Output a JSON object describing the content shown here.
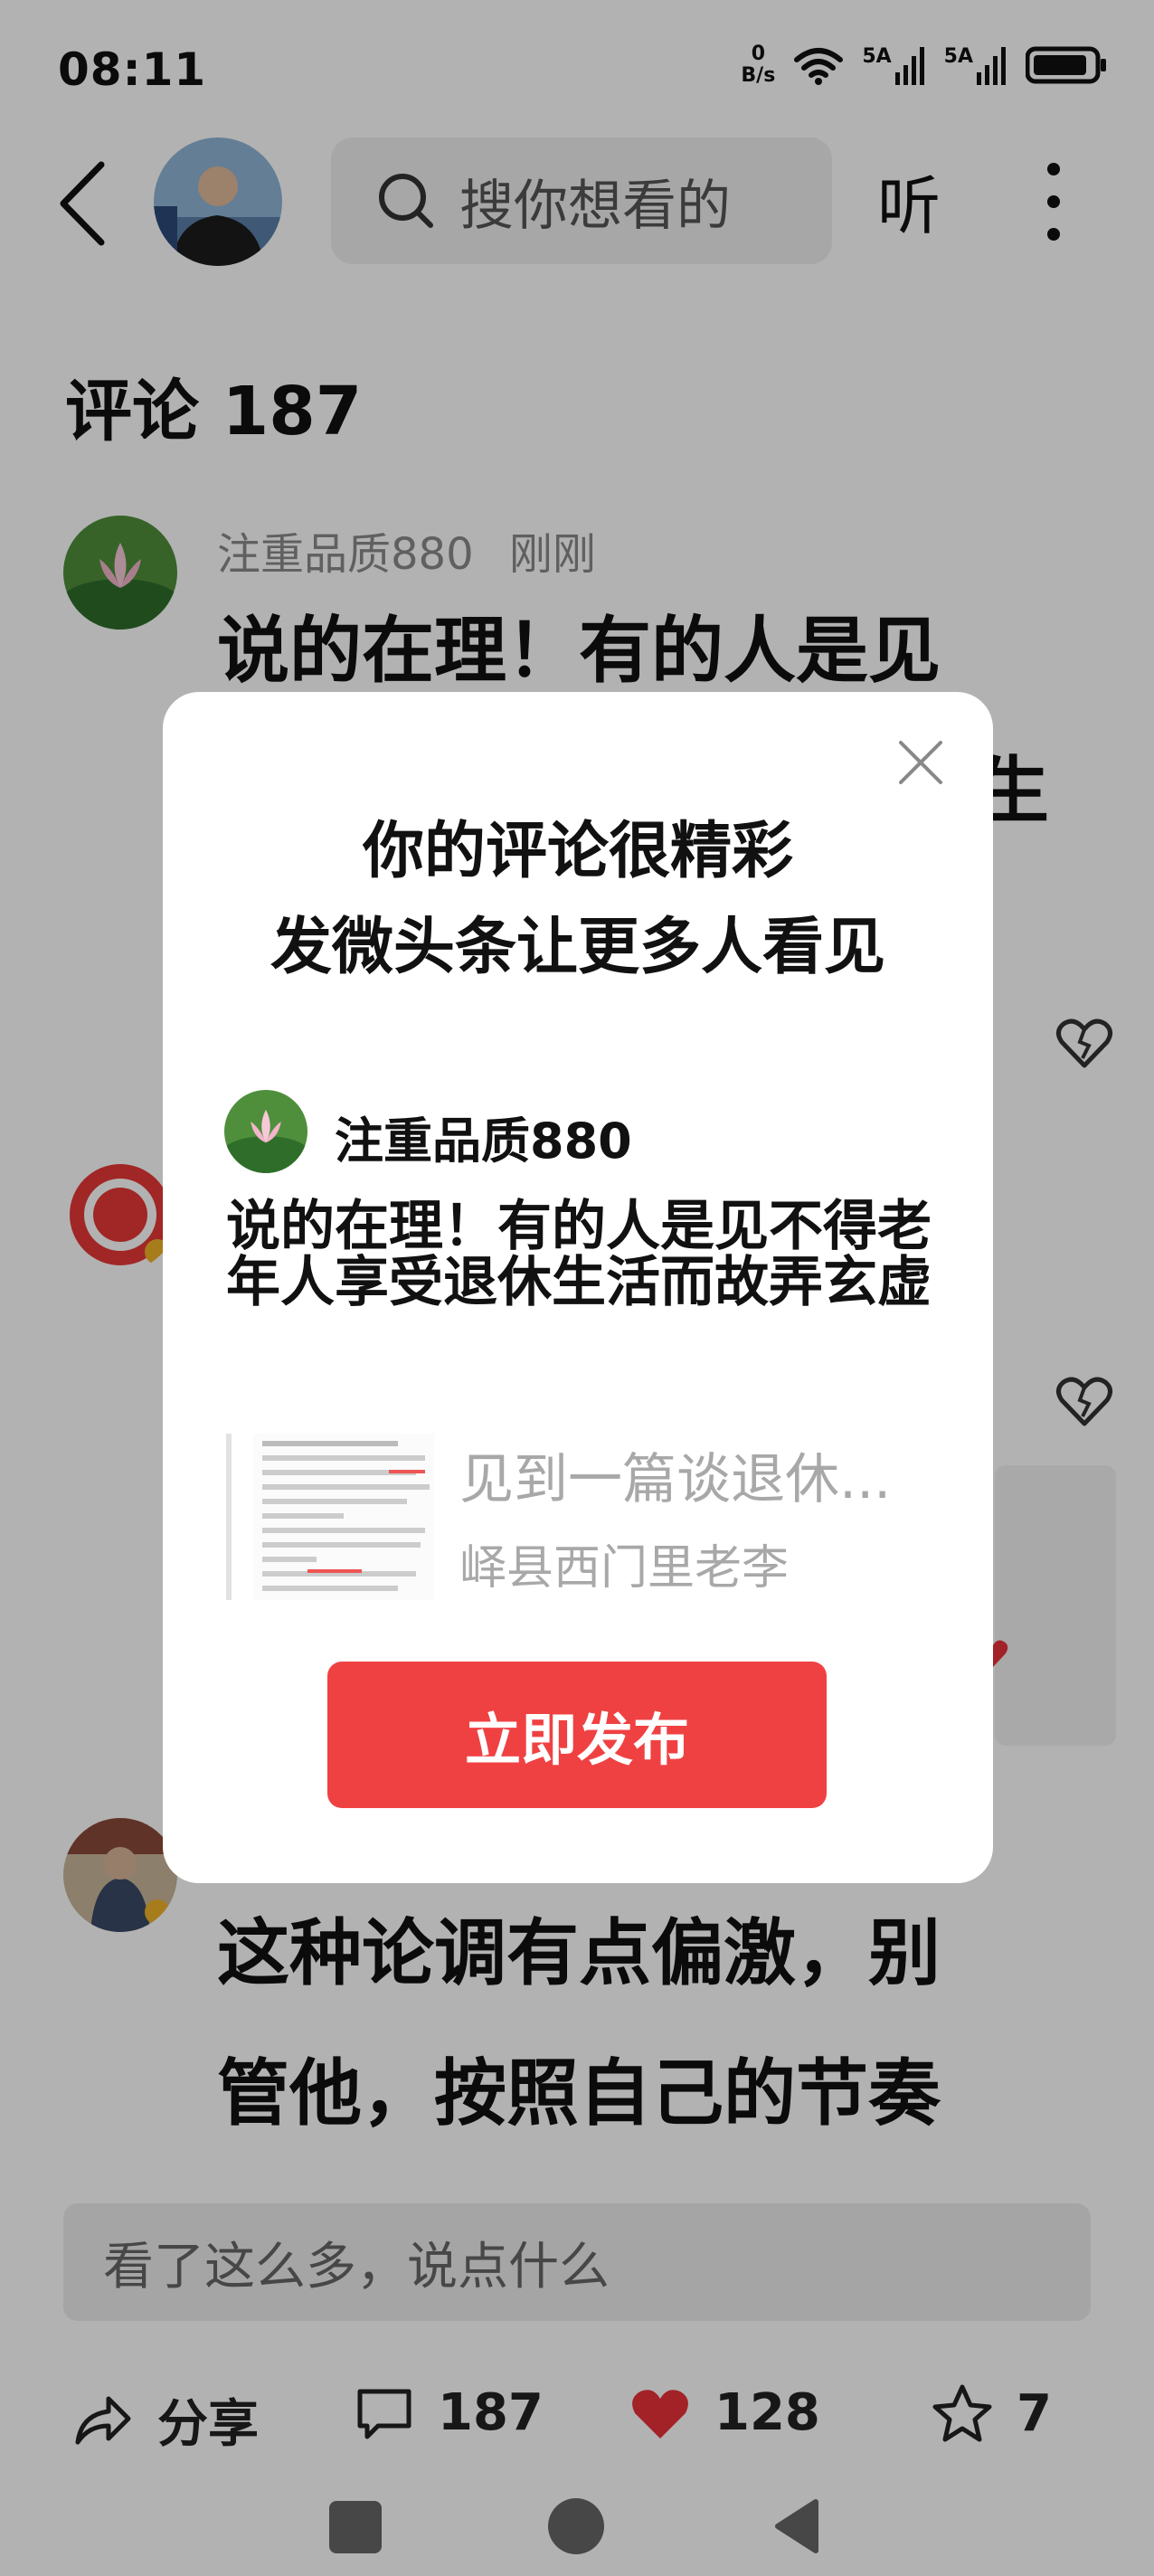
{
  "status_bar": {
    "time": "08:11",
    "net_speed_value": "0",
    "net_speed_unit": "B/s",
    "signal1_label": "5A",
    "signal2_label": "5A"
  },
  "top_bar": {
    "search_placeholder": "搜你想看的",
    "listen_label": "听"
  },
  "comments": {
    "title": "评论 187",
    "first": {
      "user": "注重品质880",
      "time": "刚刚",
      "line1": "说的在理！有的人是见",
      "line2_tail": "生"
    },
    "third": {
      "line1": "这种论调有点偏激，别",
      "line2": "管他，按照自己的节奏"
    }
  },
  "dialog": {
    "title_line1": "你的评论很精彩",
    "title_line2": "发微头条让更多人看见",
    "user": "注重品质880",
    "body": "说的在理！有的人是见不得老年人享受退休生活而故弄玄虚",
    "quote_title": "见到一篇谈退休...",
    "quote_author": "峄县西门里老李",
    "publish_label": "立即发布"
  },
  "bottom": {
    "input_placeholder": "看了这么多，说点什么",
    "share_label": "分享",
    "comment_count": "187",
    "like_count": "128",
    "favorite_count": "7"
  },
  "colors": {
    "accent_red": "#f04142",
    "like_red": "#e8323a",
    "overlay": "rgba(0,0,0,0.3)"
  }
}
